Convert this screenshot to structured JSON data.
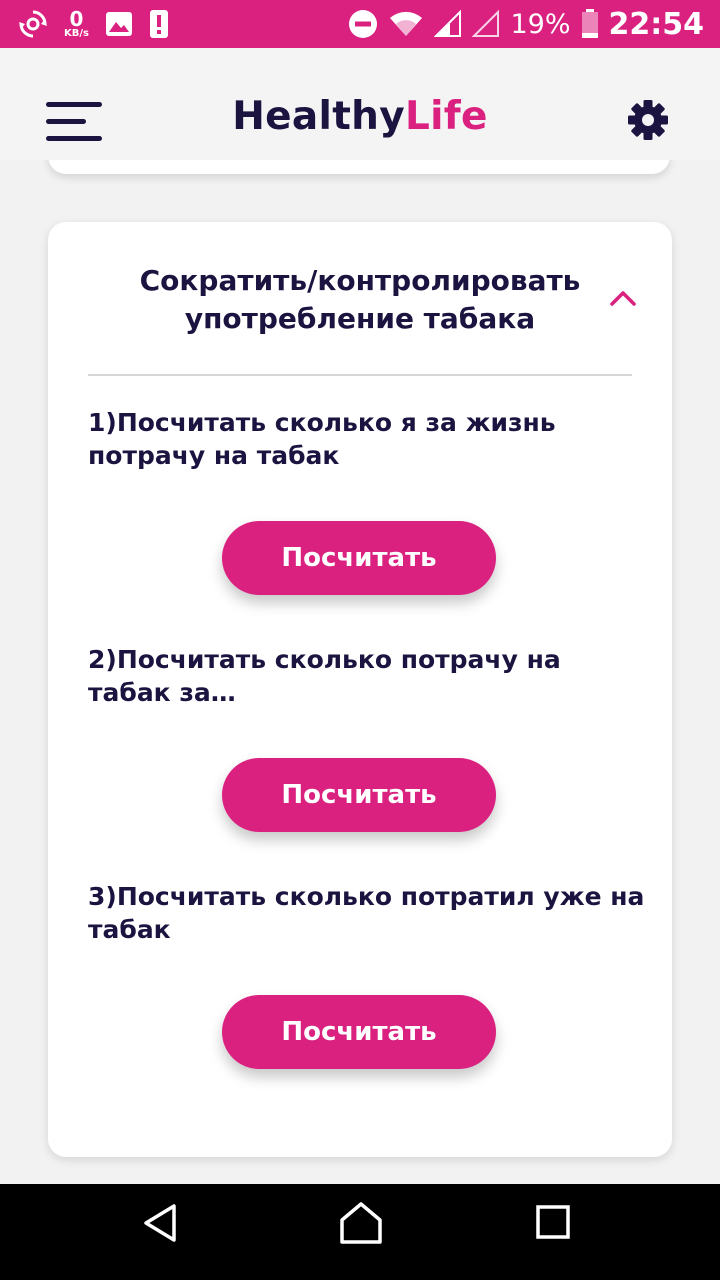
{
  "status_bar": {
    "data_speed_value": "0",
    "data_speed_unit": "KB/s",
    "battery_percent": "19%",
    "time": "22:54",
    "background_color": "#da2180"
  },
  "app_bar": {
    "title_part1": "Healthy",
    "title_part2": "Life",
    "menu_icon": "hamburger-menu-icon",
    "settings_icon": "gear-icon"
  },
  "section": {
    "title": "Сократить/контролировать употребление табака",
    "expanded": true,
    "items": [
      {
        "text": "1)Посчитать сколько я за жизнь потрачу на табак",
        "button_label": "Посчитать"
      },
      {
        "text": "2)Посчитать сколько потрачу на табак за…",
        "button_label": "Посчитать"
      },
      {
        "text": "3)Посчитать сколько потратил уже на табак",
        "button_label": "Посчитать"
      }
    ]
  },
  "colors": {
    "accent": "#da2180",
    "text_primary": "#1b1440",
    "background": "#f2f2f2",
    "card": "#ffffff"
  }
}
